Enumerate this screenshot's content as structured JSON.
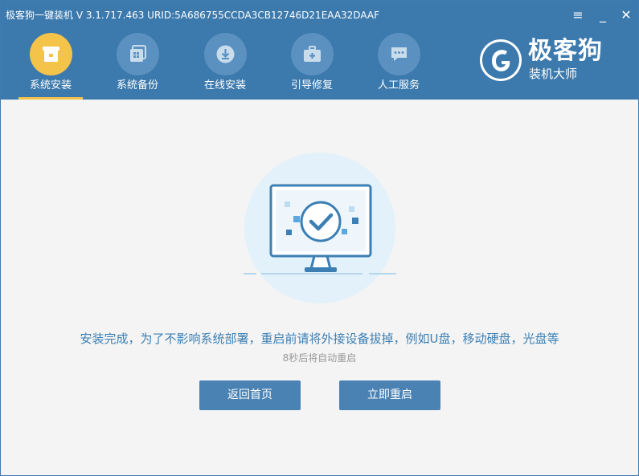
{
  "window": {
    "title": "极客狗一键装机 V 3.1.717.463 URID:5A686755CCDA3CB12746D21EAA32DAAF",
    "controls": {
      "menu": "≡",
      "minimize": "_",
      "close": "✕"
    }
  },
  "nav": {
    "items": [
      {
        "label": "系统安装",
        "icon": "box-icon",
        "active": true
      },
      {
        "label": "系统备份",
        "icon": "backup-icon",
        "active": false
      },
      {
        "label": "在线安装",
        "icon": "download-icon",
        "active": false
      },
      {
        "label": "引导修复",
        "icon": "toolbox-icon",
        "active": false
      },
      {
        "label": "人工服务",
        "icon": "chat-icon",
        "active": false
      }
    ]
  },
  "brand": {
    "name": "极客狗",
    "subtitle": "装机大师"
  },
  "main": {
    "message": "安装完成，为了不影响系统部署，重启前请将外接设备拔掉，例如U盘，移动硬盘，光盘等",
    "countdown": "8秒后将自动重启",
    "buttons": {
      "back_home": "返回首页",
      "restart_now": "立即重启"
    }
  },
  "colors": {
    "header_bg": "#3c79ad",
    "active_accent": "#f3c34a",
    "button_bg": "#4a82b3",
    "message_text": "#3c7fb4"
  }
}
